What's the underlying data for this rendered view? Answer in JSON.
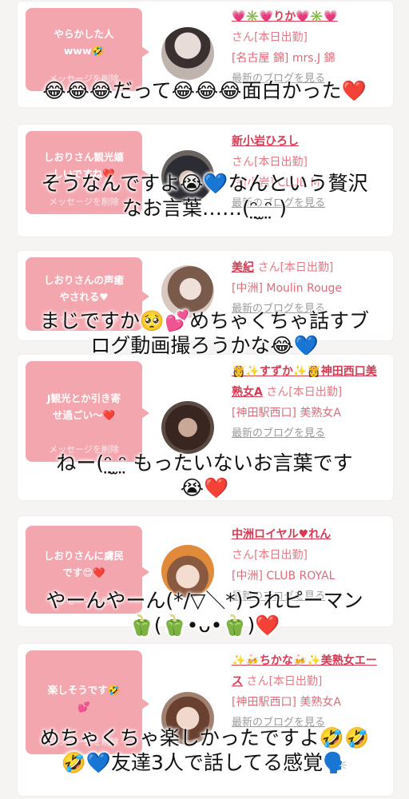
{
  "cards": [
    {
      "message": "やらかした人\nwww🤣",
      "delete_label": "メッセージを削除",
      "name": "💗✳️💗りか💗✳️💗",
      "suffix": "さん[本日出勤]",
      "shop": "[名古屋 錦] mrs.J 錦",
      "blog_link": "最新のブログを見る",
      "caption": [
        "😂😂😂だって😂😂😂面白かった❤️"
      ]
    },
    {
      "message": "しおりさん観光嬉\nしいですね❤️",
      "delete_label": "メッセージを削除",
      "name": "新小岩ひろし",
      "suffix": "さん[本日出勤]",
      "shop": "[新小岩] CLUB M.",
      "blog_link": "最新のブログを見る",
      "caption": [
        "そうなんですよ😭💙なんという贅沢",
        "なお言葉……(ᵔ̤ ̫ᵔ̤ )"
      ]
    },
    {
      "message": "しおりさんの声癒\nやされる♥",
      "delete_label": "メッセージを削除",
      "name": "美紀",
      "suffix": "さん[本日出勤]",
      "shop": "[中洲] Moulin Rouge",
      "blog_link": "最新のブログを見る",
      "caption": [
        "まじですか🥺💕めちゃくちゃ話すブ",
        "ログ動画撮ろうかな😂💙"
      ]
    },
    {
      "message": "J観光とか引き寄\nせ過ごい〜❤️",
      "delete_label": "メッセージを削除",
      "name": "👸✨すずか✨👸神田西口美熟女A",
      "suffix": "さん[本日出勤]",
      "shop": "[神田駅西口] 美熟女A",
      "blog_link": "最新のブログを見る",
      "caption": [
        "ねー(ᵔ̤ ̫ᵔ̤ もったいないお言葉です",
        "😭❤️"
      ]
    },
    {
      "message": "しおりさんに虜民\nです😍❤️",
      "delete_label": "メッセージを削除",
      "name": "中洲ロイヤル♥れん",
      "suffix": "さん[本日出勤]",
      "shop": "[中洲] CLUB ROYAL",
      "blog_link": "最新のブログを見る",
      "caption": [
        "やーんやーん(*/▽＼*)うれピーマン",
        "🫑(🫑•ᴗ•🫑)❤️"
      ]
    },
    {
      "message": "楽しそうです🤣\n💕",
      "delete_label": "メッセージを削除",
      "name": "✨🍻ちかな🍻✨美熟女エース",
      "suffix": "さん[本日出勤]",
      "shop": "[神田駅西口] 美熟女A",
      "blog_link": "最新のブログを見る",
      "caption": [
        "めちゃくちゃ楽しかったですよ🤣🤣",
        "🤣💙友達3人で話してる感覚🗣️"
      ]
    }
  ],
  "colors": {
    "bubble": "#f4a6ae",
    "name": "#d63a52",
    "shop": "#e06a78",
    "background": "#f6f3f3"
  }
}
